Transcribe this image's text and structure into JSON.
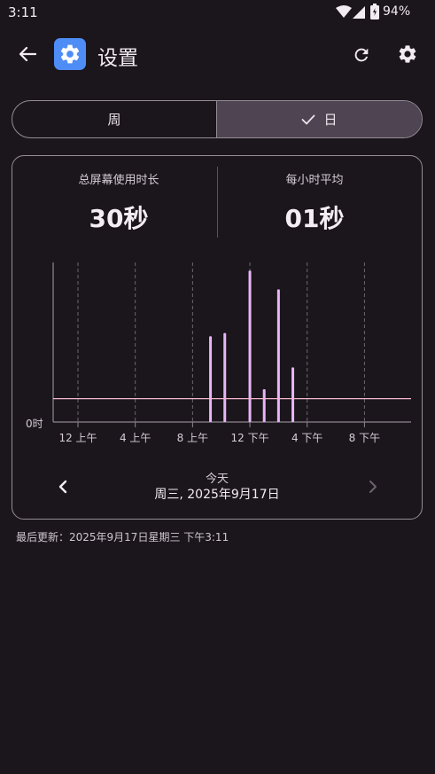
{
  "status": {
    "time": "3:11",
    "battery": "94%"
  },
  "app_bar": {
    "title": "设置",
    "icons": {
      "back": "arrow-left-icon",
      "app": "gear-icon",
      "refresh": "refresh-icon",
      "settings": "gear-icon"
    }
  },
  "segments": {
    "week": "周",
    "day": "日",
    "selected": "day"
  },
  "stats": {
    "total_label": "总屏幕使用时长",
    "total_value": "30秒",
    "hourly_label": "每小时平均",
    "hourly_value": "01秒"
  },
  "chart_data": {
    "type": "bar",
    "title": "",
    "xlabel": "",
    "ylabel": "",
    "y_tick_label": "0时",
    "x_ticks": [
      "12 上午",
      "4 上午",
      "8 上午",
      "12 下午",
      "4 下午",
      "8 下午"
    ],
    "x_tick_hours": [
      0,
      4,
      8,
      12,
      16,
      20
    ],
    "bars": [
      {
        "hour": 9.25,
        "value": 0.55
      },
      {
        "hour": 10.25,
        "value": 0.57
      },
      {
        "hour": 12.0,
        "value": 0.97
      },
      {
        "hour": 13.0,
        "value": 0.21
      },
      {
        "hour": 14.0,
        "value": 0.85
      },
      {
        "hour": 15.0,
        "value": 0.35
      }
    ],
    "average_line": 0.15,
    "colors": {
      "bar": "#e7b6f7",
      "average": "#f3b7cd",
      "grid": "#6e6670",
      "axis": "#8f8791"
    }
  },
  "date_nav": {
    "label": "今天",
    "date": "周三, 2025年9月17日"
  },
  "footer": {
    "last_updated": "最后更新：2025年9月17日星期三 下午3:11"
  }
}
